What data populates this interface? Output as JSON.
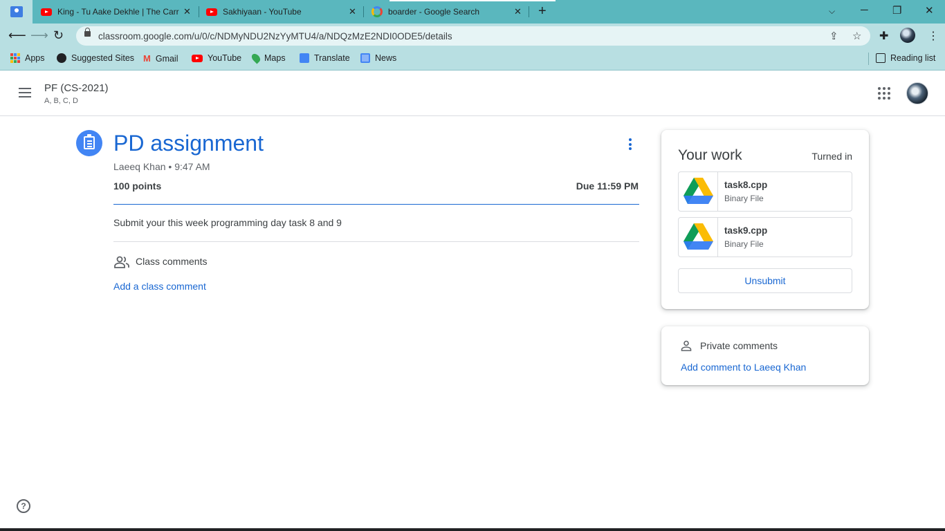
{
  "browser": {
    "tabs": [
      {
        "title": "",
        "icon": "google-classroom-icon",
        "active": false
      },
      {
        "title": "King - Tu Aake Dekhle | The Carr",
        "icon": "youtube-icon"
      },
      {
        "title": "Sakhiyaan - YouTube",
        "icon": "youtube-icon"
      },
      {
        "title": "boarder - Google Search",
        "icon": "google-icon"
      }
    ],
    "url": "classroom.google.com/u/0/c/NDMyNDU2NzYyMTU4/a/NDQzMzE2NDI0ODE5/details",
    "bookmarks": [
      {
        "label": "Apps"
      },
      {
        "label": "Suggested Sites"
      },
      {
        "label": "Gmail"
      },
      {
        "label": "YouTube"
      },
      {
        "label": "Maps"
      },
      {
        "label": "Translate"
      },
      {
        "label": "News"
      }
    ],
    "reading_list": "Reading list",
    "accent": "#5ab7be",
    "toolbar_color": "#b8dfe2"
  },
  "header": {
    "course_name": "PF (CS-2021)",
    "course_section": "A, B, C, D"
  },
  "assignment": {
    "title": "PD assignment",
    "meta": "Laeeq Khan • 9:47 AM",
    "points": "100 points",
    "due": "Due 11:59 PM",
    "instructions": "Submit your this week programming day task 8 and 9",
    "class_comments_label": "Class comments",
    "add_class_comment": "Add a class comment"
  },
  "your_work": {
    "title": "Your work",
    "status": "Turned in",
    "files": [
      {
        "name": "task8.cpp",
        "type": "Binary File"
      },
      {
        "name": "task9.cpp",
        "type": "Binary File"
      }
    ],
    "unsubmit_label": "Unsubmit"
  },
  "private_comments": {
    "label": "Private comments",
    "add_link": "Add comment to Laeeq Khan"
  },
  "colors": {
    "link_blue": "#1967d2",
    "icon_blue": "#4285f4"
  }
}
